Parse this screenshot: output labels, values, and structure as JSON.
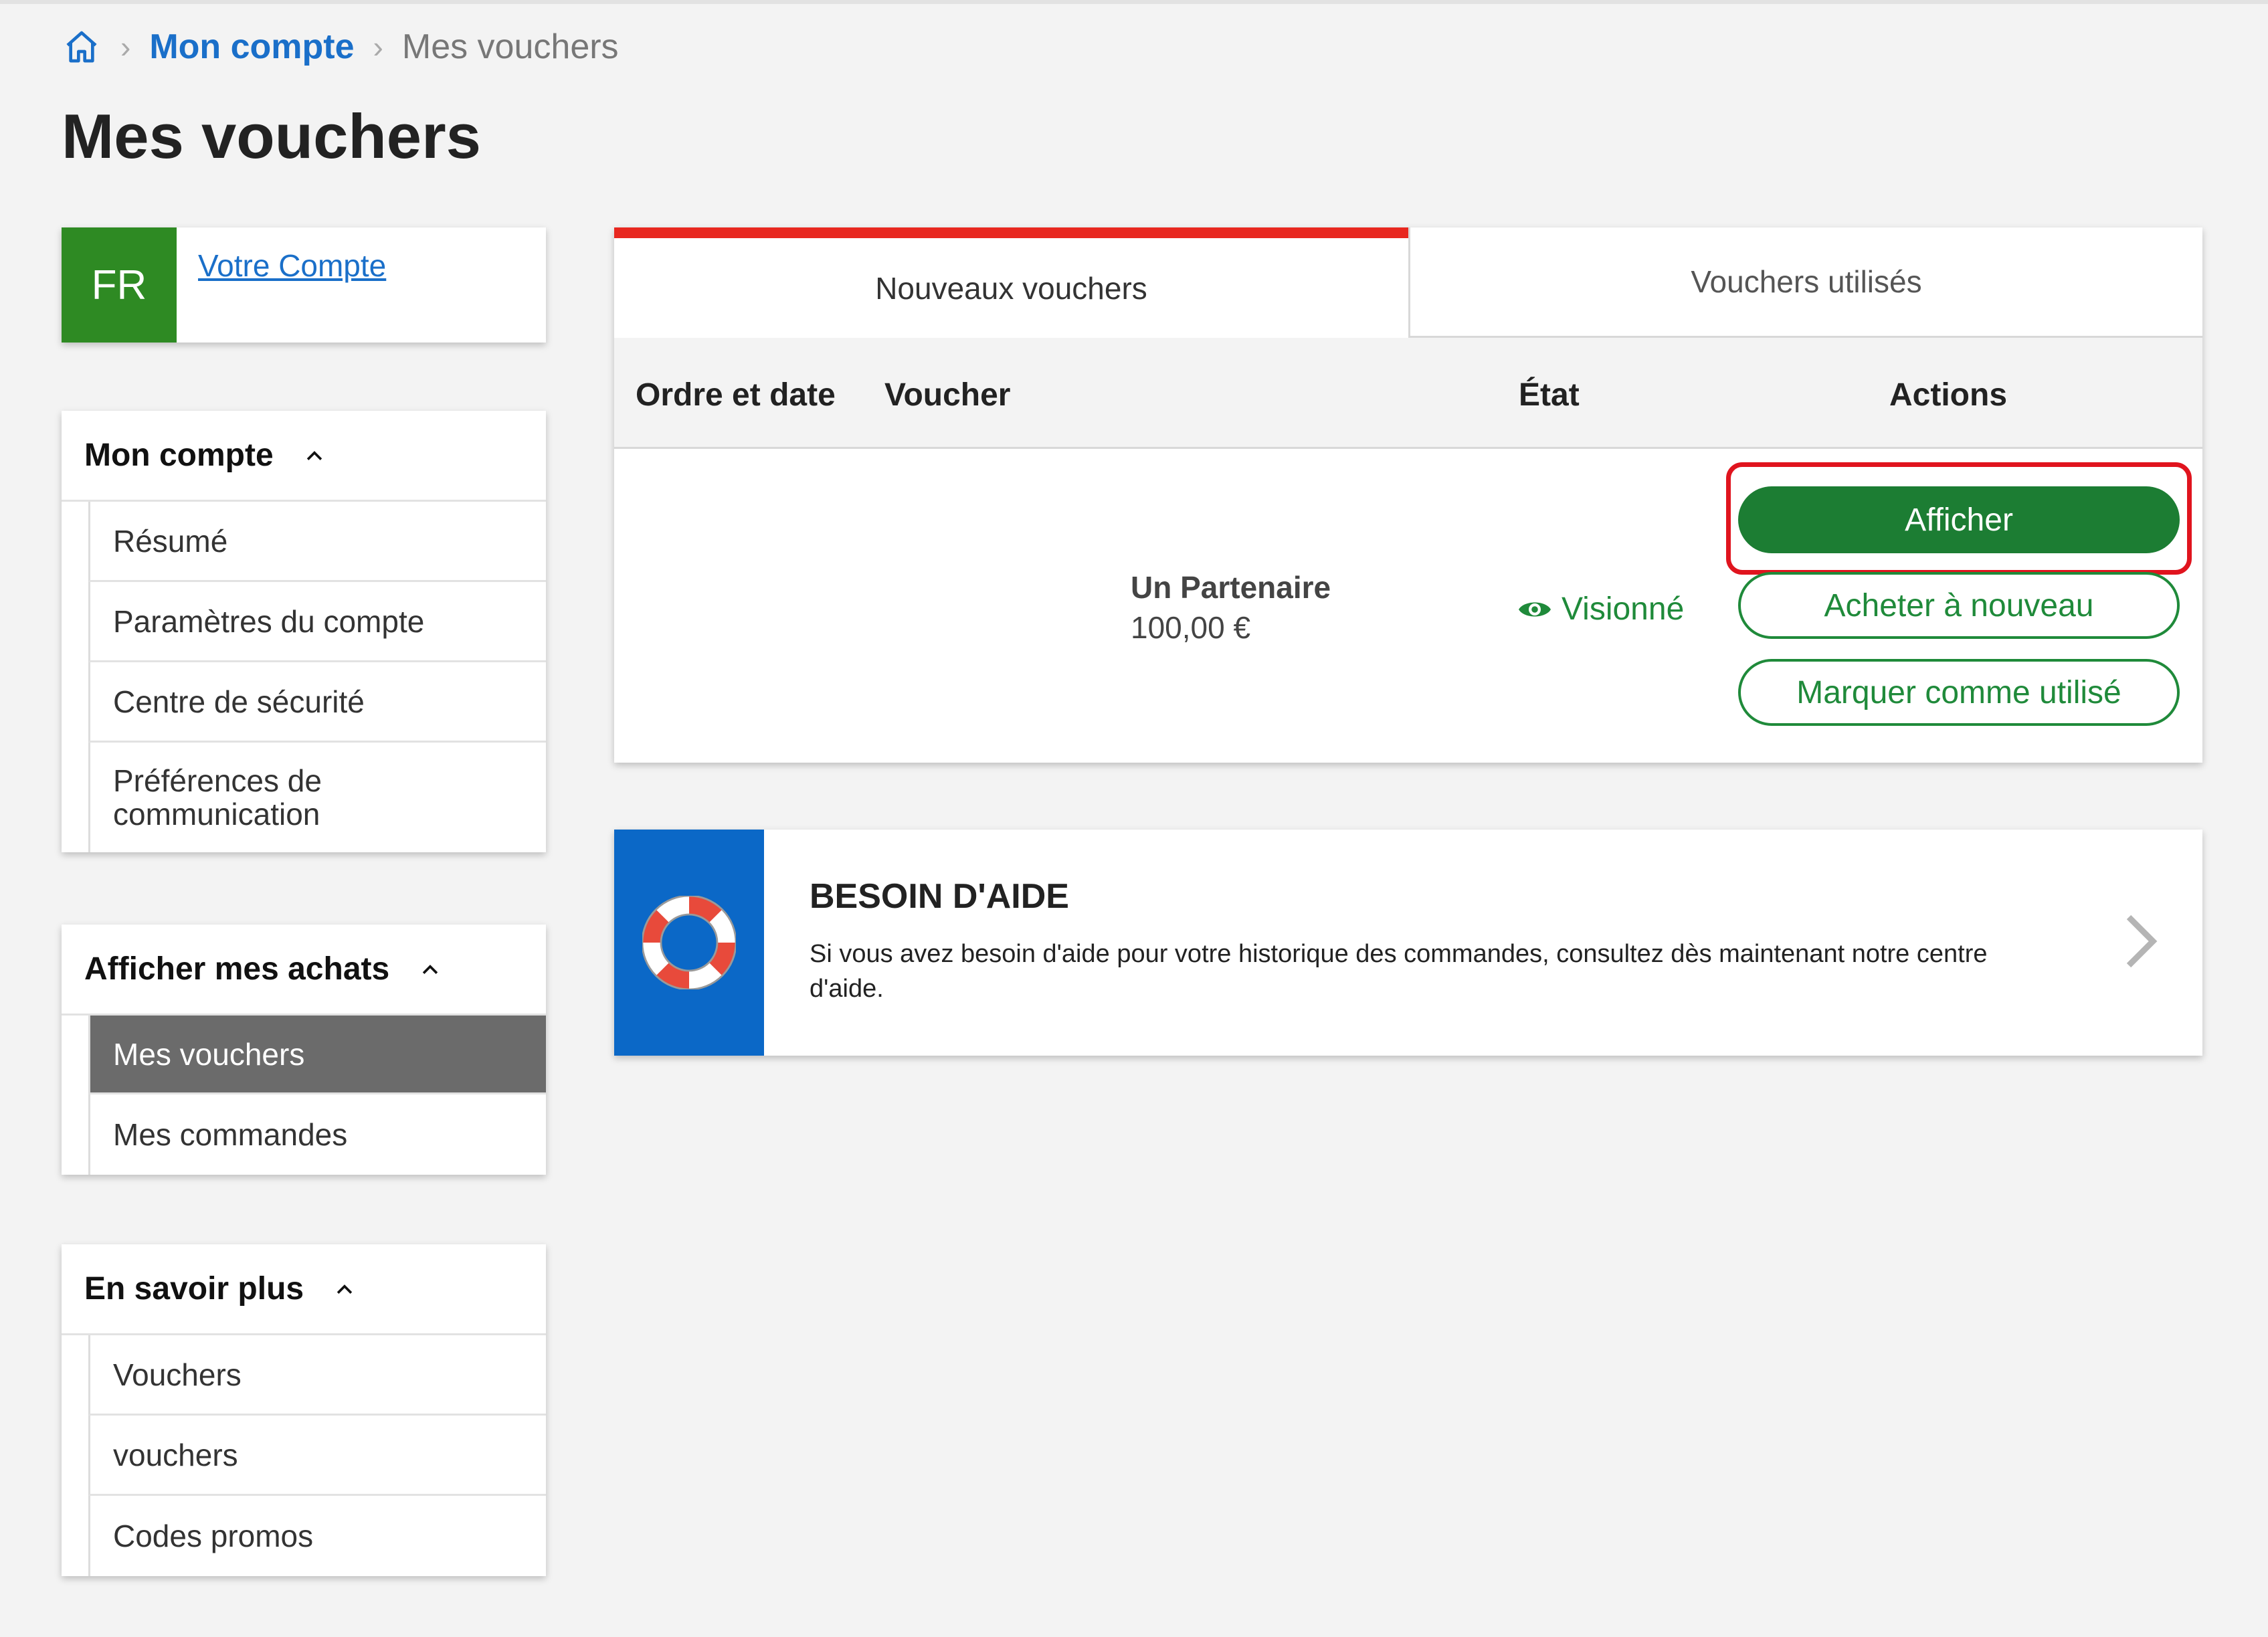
{
  "breadcrumb": {
    "home_icon": "home-icon",
    "items": [
      {
        "label": "Mon compte"
      },
      {
        "label": "Mes vouchers"
      }
    ]
  },
  "page_title": "Mes vouchers",
  "account": {
    "avatar_initials": "FR",
    "link_label": "Votre Compte",
    "avatar_color": "#2e8a23"
  },
  "menus": [
    {
      "title": "Mon compte",
      "items": [
        "Résumé",
        "Paramètres du compte",
        "Centre de sécurité",
        "Préférences de communication"
      ]
    },
    {
      "title": "Afficher mes achats",
      "items": [
        "Mes vouchers",
        "Mes commandes"
      ],
      "active_item": "Mes vouchers"
    },
    {
      "title": "En savoir plus",
      "items": [
        "Vouchers",
        "vouchers",
        "Codes promos"
      ]
    }
  ],
  "tabs": [
    {
      "label": "Nouveaux vouchers",
      "active": true
    },
    {
      "label": "Vouchers utilisés",
      "active": false
    }
  ],
  "table": {
    "columns": [
      "Ordre et date",
      "Voucher",
      "État",
      "Actions"
    ],
    "rows": [
      {
        "order_date": "",
        "voucher_name": "Un Partenaire",
        "voucher_price": "100,00 €",
        "status": "Visionné",
        "actions": [
          "Afficher",
          "Acheter à nouveau",
          "Marquer comme utilisé"
        ]
      }
    ]
  },
  "help": {
    "title": "BESOIN D'AIDE",
    "text": "Si vous avez besoin d'aide pour votre historique des commandes, consultez dès maintenant notre centre d'aide.",
    "icon": "lifebuoy-icon"
  },
  "colors": {
    "accent_red": "#e8271f",
    "primary_green": "#1c7d33",
    "link_blue": "#1a6fc9",
    "help_blue": "#0b68c7"
  }
}
